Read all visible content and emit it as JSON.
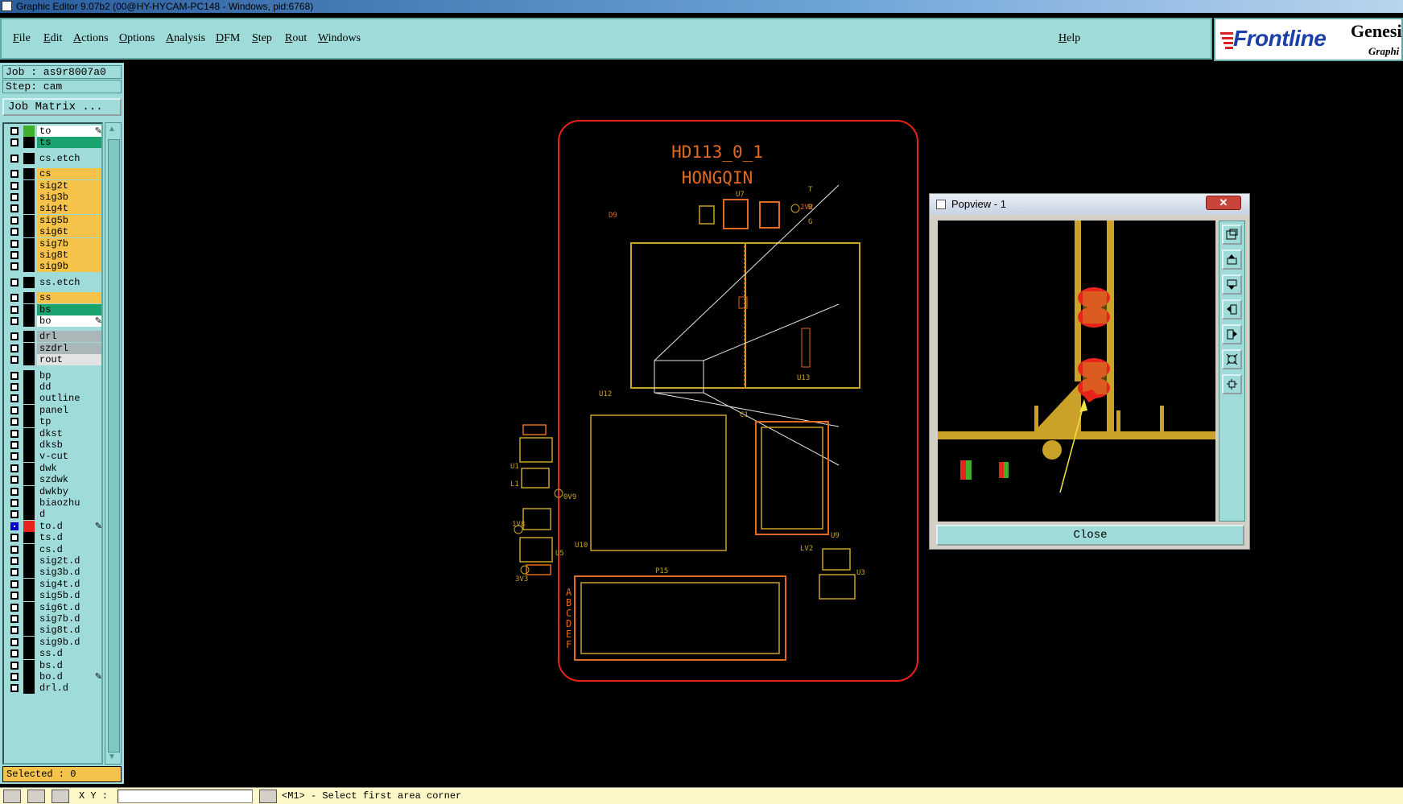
{
  "window": {
    "title": "Graphic Editor 9.07b2 (00@HY-HYCAM-PC148 - Windows, pid:6768)"
  },
  "menu": {
    "items": [
      "File",
      "Edit",
      "Actions",
      "Options",
      "Analysis",
      "DFM",
      "Step",
      "Rout",
      "Windows"
    ],
    "help": "Help"
  },
  "brand": {
    "name": "Frontline",
    "product": "Genesi",
    "sub": "Graphi"
  },
  "job": {
    "job_label": "Job : as9r8007a0",
    "step_label": "Step: cam",
    "matrix_button": "Job Matrix ..."
  },
  "layers": [
    {
      "name": "to",
      "color": "#ffffff",
      "swatch": "#3fae2a",
      "mark": "pen",
      "checked": false
    },
    {
      "name": "ts",
      "color": "#1aa36e",
      "swatch": "#000000",
      "checked": false
    },
    {
      "name": "cs.etch",
      "color": "#9fdcd9",
      "swatch": "#000000",
      "checked": false
    },
    {
      "name": "cs",
      "color": "#f5c24a",
      "swatch": "#000000",
      "checked": false
    },
    {
      "name": "sig2t",
      "color": "#f5c24a",
      "swatch": "#000000",
      "checked": false
    },
    {
      "name": "sig3b",
      "color": "#f5c24a",
      "swatch": "#000000",
      "checked": false
    },
    {
      "name": "sig4t",
      "color": "#f5c24a",
      "swatch": "#000000",
      "checked": false
    },
    {
      "name": "sig5b",
      "color": "#f5c24a",
      "swatch": "#000000",
      "checked": false
    },
    {
      "name": "sig6t",
      "color": "#f5c24a",
      "swatch": "#000000",
      "checked": false
    },
    {
      "name": "sig7b",
      "color": "#f5c24a",
      "swatch": "#000000",
      "checked": false
    },
    {
      "name": "sig8t",
      "color": "#f5c24a",
      "swatch": "#000000",
      "checked": false
    },
    {
      "name": "sig9b",
      "color": "#f5c24a",
      "swatch": "#000000",
      "checked": false
    },
    {
      "name": "ss.etch",
      "color": "#9fdcd9",
      "swatch": "#000000",
      "checked": false
    },
    {
      "name": "ss",
      "color": "#f5c24a",
      "swatch": "#000000",
      "checked": false
    },
    {
      "name": "bs",
      "color": "#1aa36e",
      "swatch": "#000000",
      "checked": false
    },
    {
      "name": "bo",
      "color": "#ffffff",
      "swatch": "#000000",
      "mark": "pen",
      "checked": false
    },
    {
      "name": "drl",
      "color": "#a9b7b8",
      "swatch": "#000000",
      "checked": false
    },
    {
      "name": "szdrl",
      "color": "#a9b7b8",
      "swatch": "#000000",
      "checked": false
    },
    {
      "name": "rout",
      "color": "#e3e3e3",
      "swatch": "#000000",
      "checked": false
    },
    {
      "name": "bp",
      "color": "#9fdcd9",
      "swatch": "#000000",
      "checked": false
    },
    {
      "name": "dd",
      "color": "#9fdcd9",
      "swatch": "#000000",
      "checked": false
    },
    {
      "name": "outline",
      "color": "#9fdcd9",
      "swatch": "#000000",
      "checked": false
    },
    {
      "name": "panel",
      "color": "#9fdcd9",
      "swatch": "#000000",
      "checked": false
    },
    {
      "name": "tp",
      "color": "#9fdcd9",
      "swatch": "#000000",
      "checked": false
    },
    {
      "name": "dkst",
      "color": "#9fdcd9",
      "swatch": "#000000",
      "checked": false
    },
    {
      "name": "dksb",
      "color": "#9fdcd9",
      "swatch": "#000000",
      "checked": false
    },
    {
      "name": "v-cut",
      "color": "#9fdcd9",
      "swatch": "#000000",
      "checked": false
    },
    {
      "name": "dwk",
      "color": "#9fdcd9",
      "swatch": "#000000",
      "checked": false
    },
    {
      "name": "szdwk",
      "color": "#9fdcd9",
      "swatch": "#000000",
      "checked": false
    },
    {
      "name": "dwkby",
      "color": "#9fdcd9",
      "swatch": "#000000",
      "checked": false
    },
    {
      "name": "biaozhu",
      "color": "#9fdcd9",
      "swatch": "#000000",
      "checked": false
    },
    {
      "name": "d",
      "color": "#9fdcd9",
      "swatch": "#000000",
      "checked": false
    },
    {
      "name": "to.d",
      "color": "#9fdcd9",
      "swatch": "#e8231b",
      "mark": "pen",
      "checked": true
    },
    {
      "name": "ts.d",
      "color": "#9fdcd9",
      "swatch": "#000000",
      "checked": false
    },
    {
      "name": "cs.d",
      "color": "#9fdcd9",
      "swatch": "#000000",
      "checked": false
    },
    {
      "name": "sig2t.d",
      "color": "#9fdcd9",
      "swatch": "#000000",
      "checked": false
    },
    {
      "name": "sig3b.d",
      "color": "#9fdcd9",
      "swatch": "#000000",
      "checked": false
    },
    {
      "name": "sig4t.d",
      "color": "#9fdcd9",
      "swatch": "#000000",
      "checked": false
    },
    {
      "name": "sig5b.d",
      "color": "#9fdcd9",
      "swatch": "#000000",
      "checked": false
    },
    {
      "name": "sig6t.d",
      "color": "#9fdcd9",
      "swatch": "#000000",
      "checked": false
    },
    {
      "name": "sig7b.d",
      "color": "#9fdcd9",
      "swatch": "#000000",
      "checked": false
    },
    {
      "name": "sig8t.d",
      "color": "#9fdcd9",
      "swatch": "#000000",
      "checked": false
    },
    {
      "name": "sig9b.d",
      "color": "#9fdcd9",
      "swatch": "#000000",
      "checked": false
    },
    {
      "name": "ss.d",
      "color": "#9fdcd9",
      "swatch": "#000000",
      "checked": false
    },
    {
      "name": "bs.d",
      "color": "#9fdcd9",
      "swatch": "#000000",
      "checked": false
    },
    {
      "name": "bo.d",
      "color": "#9fdcd9",
      "swatch": "#000000",
      "mark": "pen",
      "checked": false
    },
    {
      "name": "drl.d",
      "color": "#9fdcd9",
      "swatch": "#000000",
      "checked": false
    }
  ],
  "selected_label": "Selected : 0",
  "status": {
    "xy_label": "X Y :",
    "xy_value": "",
    "message": "<M1> - Select first area corner"
  },
  "board": {
    "title_line1": "HD113_0_1",
    "title_line2": "HONGQIN",
    "refs": [
      "U7",
      "U12",
      "U13",
      "U10",
      "U1",
      "U5",
      "U9",
      "U3",
      "P15",
      "C1",
      "L1",
      "LV2",
      "1V8",
      "3V3",
      "2V2",
      "0V9",
      "D9"
    ],
    "connector_letters": [
      "A",
      "B",
      "C",
      "D",
      "E",
      "F"
    ],
    "side_letters": [
      "T",
      "R",
      "G"
    ]
  },
  "popview": {
    "title": "Popview - 1",
    "close_x": "✕",
    "close_button": "Close",
    "tools": [
      "zoom-fit-icon",
      "pan-up-icon",
      "pan-down-icon",
      "pan-left-icon",
      "pan-right-icon",
      "zoom-in-icon",
      "zoom-out-icon"
    ]
  },
  "colors": {
    "panel_bg": "#9fdcd9",
    "board_outline": "#e8231b",
    "copper": "#c9a227",
    "silk": "#e06a1f",
    "highlight": "#f5c24a"
  }
}
